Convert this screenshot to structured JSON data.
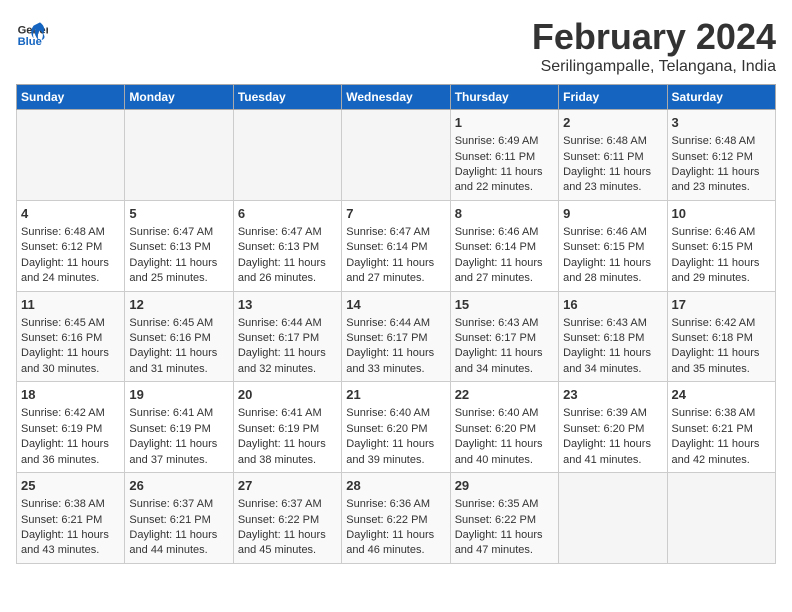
{
  "header": {
    "logo_line1": "General",
    "logo_line2": "Blue",
    "title": "February 2024",
    "subtitle": "Serilingampalle, Telangana, India"
  },
  "days_of_week": [
    "Sunday",
    "Monday",
    "Tuesday",
    "Wednesday",
    "Thursday",
    "Friday",
    "Saturday"
  ],
  "weeks": [
    [
      {
        "day": "",
        "empty": true
      },
      {
        "day": "",
        "empty": true
      },
      {
        "day": "",
        "empty": true
      },
      {
        "day": "",
        "empty": true
      },
      {
        "day": "1",
        "line1": "Sunrise: 6:49 AM",
        "line2": "Sunset: 6:11 PM",
        "line3": "Daylight: 11 hours",
        "line4": "and 22 minutes."
      },
      {
        "day": "2",
        "line1": "Sunrise: 6:48 AM",
        "line2": "Sunset: 6:11 PM",
        "line3": "Daylight: 11 hours",
        "line4": "and 23 minutes."
      },
      {
        "day": "3",
        "line1": "Sunrise: 6:48 AM",
        "line2": "Sunset: 6:12 PM",
        "line3": "Daylight: 11 hours",
        "line4": "and 23 minutes."
      }
    ],
    [
      {
        "day": "4",
        "line1": "Sunrise: 6:48 AM",
        "line2": "Sunset: 6:12 PM",
        "line3": "Daylight: 11 hours",
        "line4": "and 24 minutes."
      },
      {
        "day": "5",
        "line1": "Sunrise: 6:47 AM",
        "line2": "Sunset: 6:13 PM",
        "line3": "Daylight: 11 hours",
        "line4": "and 25 minutes."
      },
      {
        "day": "6",
        "line1": "Sunrise: 6:47 AM",
        "line2": "Sunset: 6:13 PM",
        "line3": "Daylight: 11 hours",
        "line4": "and 26 minutes."
      },
      {
        "day": "7",
        "line1": "Sunrise: 6:47 AM",
        "line2": "Sunset: 6:14 PM",
        "line3": "Daylight: 11 hours",
        "line4": "and 27 minutes."
      },
      {
        "day": "8",
        "line1": "Sunrise: 6:46 AM",
        "line2": "Sunset: 6:14 PM",
        "line3": "Daylight: 11 hours",
        "line4": "and 27 minutes."
      },
      {
        "day": "9",
        "line1": "Sunrise: 6:46 AM",
        "line2": "Sunset: 6:15 PM",
        "line3": "Daylight: 11 hours",
        "line4": "and 28 minutes."
      },
      {
        "day": "10",
        "line1": "Sunrise: 6:46 AM",
        "line2": "Sunset: 6:15 PM",
        "line3": "Daylight: 11 hours",
        "line4": "and 29 minutes."
      }
    ],
    [
      {
        "day": "11",
        "line1": "Sunrise: 6:45 AM",
        "line2": "Sunset: 6:16 PM",
        "line3": "Daylight: 11 hours",
        "line4": "and 30 minutes."
      },
      {
        "day": "12",
        "line1": "Sunrise: 6:45 AM",
        "line2": "Sunset: 6:16 PM",
        "line3": "Daylight: 11 hours",
        "line4": "and 31 minutes."
      },
      {
        "day": "13",
        "line1": "Sunrise: 6:44 AM",
        "line2": "Sunset: 6:17 PM",
        "line3": "Daylight: 11 hours",
        "line4": "and 32 minutes."
      },
      {
        "day": "14",
        "line1": "Sunrise: 6:44 AM",
        "line2": "Sunset: 6:17 PM",
        "line3": "Daylight: 11 hours",
        "line4": "and 33 minutes."
      },
      {
        "day": "15",
        "line1": "Sunrise: 6:43 AM",
        "line2": "Sunset: 6:17 PM",
        "line3": "Daylight: 11 hours",
        "line4": "and 34 minutes."
      },
      {
        "day": "16",
        "line1": "Sunrise: 6:43 AM",
        "line2": "Sunset: 6:18 PM",
        "line3": "Daylight: 11 hours",
        "line4": "and 34 minutes."
      },
      {
        "day": "17",
        "line1": "Sunrise: 6:42 AM",
        "line2": "Sunset: 6:18 PM",
        "line3": "Daylight: 11 hours",
        "line4": "and 35 minutes."
      }
    ],
    [
      {
        "day": "18",
        "line1": "Sunrise: 6:42 AM",
        "line2": "Sunset: 6:19 PM",
        "line3": "Daylight: 11 hours",
        "line4": "and 36 minutes."
      },
      {
        "day": "19",
        "line1": "Sunrise: 6:41 AM",
        "line2": "Sunset: 6:19 PM",
        "line3": "Daylight: 11 hours",
        "line4": "and 37 minutes."
      },
      {
        "day": "20",
        "line1": "Sunrise: 6:41 AM",
        "line2": "Sunset: 6:19 PM",
        "line3": "Daylight: 11 hours",
        "line4": "and 38 minutes."
      },
      {
        "day": "21",
        "line1": "Sunrise: 6:40 AM",
        "line2": "Sunset: 6:20 PM",
        "line3": "Daylight: 11 hours",
        "line4": "and 39 minutes."
      },
      {
        "day": "22",
        "line1": "Sunrise: 6:40 AM",
        "line2": "Sunset: 6:20 PM",
        "line3": "Daylight: 11 hours",
        "line4": "and 40 minutes."
      },
      {
        "day": "23",
        "line1": "Sunrise: 6:39 AM",
        "line2": "Sunset: 6:20 PM",
        "line3": "Daylight: 11 hours",
        "line4": "and 41 minutes."
      },
      {
        "day": "24",
        "line1": "Sunrise: 6:38 AM",
        "line2": "Sunset: 6:21 PM",
        "line3": "Daylight: 11 hours",
        "line4": "and 42 minutes."
      }
    ],
    [
      {
        "day": "25",
        "line1": "Sunrise: 6:38 AM",
        "line2": "Sunset: 6:21 PM",
        "line3": "Daylight: 11 hours",
        "line4": "and 43 minutes."
      },
      {
        "day": "26",
        "line1": "Sunrise: 6:37 AM",
        "line2": "Sunset: 6:21 PM",
        "line3": "Daylight: 11 hours",
        "line4": "and 44 minutes."
      },
      {
        "day": "27",
        "line1": "Sunrise: 6:37 AM",
        "line2": "Sunset: 6:22 PM",
        "line3": "Daylight: 11 hours",
        "line4": "and 45 minutes."
      },
      {
        "day": "28",
        "line1": "Sunrise: 6:36 AM",
        "line2": "Sunset: 6:22 PM",
        "line3": "Daylight: 11 hours",
        "line4": "and 46 minutes."
      },
      {
        "day": "29",
        "line1": "Sunrise: 6:35 AM",
        "line2": "Sunset: 6:22 PM",
        "line3": "Daylight: 11 hours",
        "line4": "and 47 minutes."
      },
      {
        "day": "",
        "empty": true
      },
      {
        "day": "",
        "empty": true
      }
    ]
  ]
}
